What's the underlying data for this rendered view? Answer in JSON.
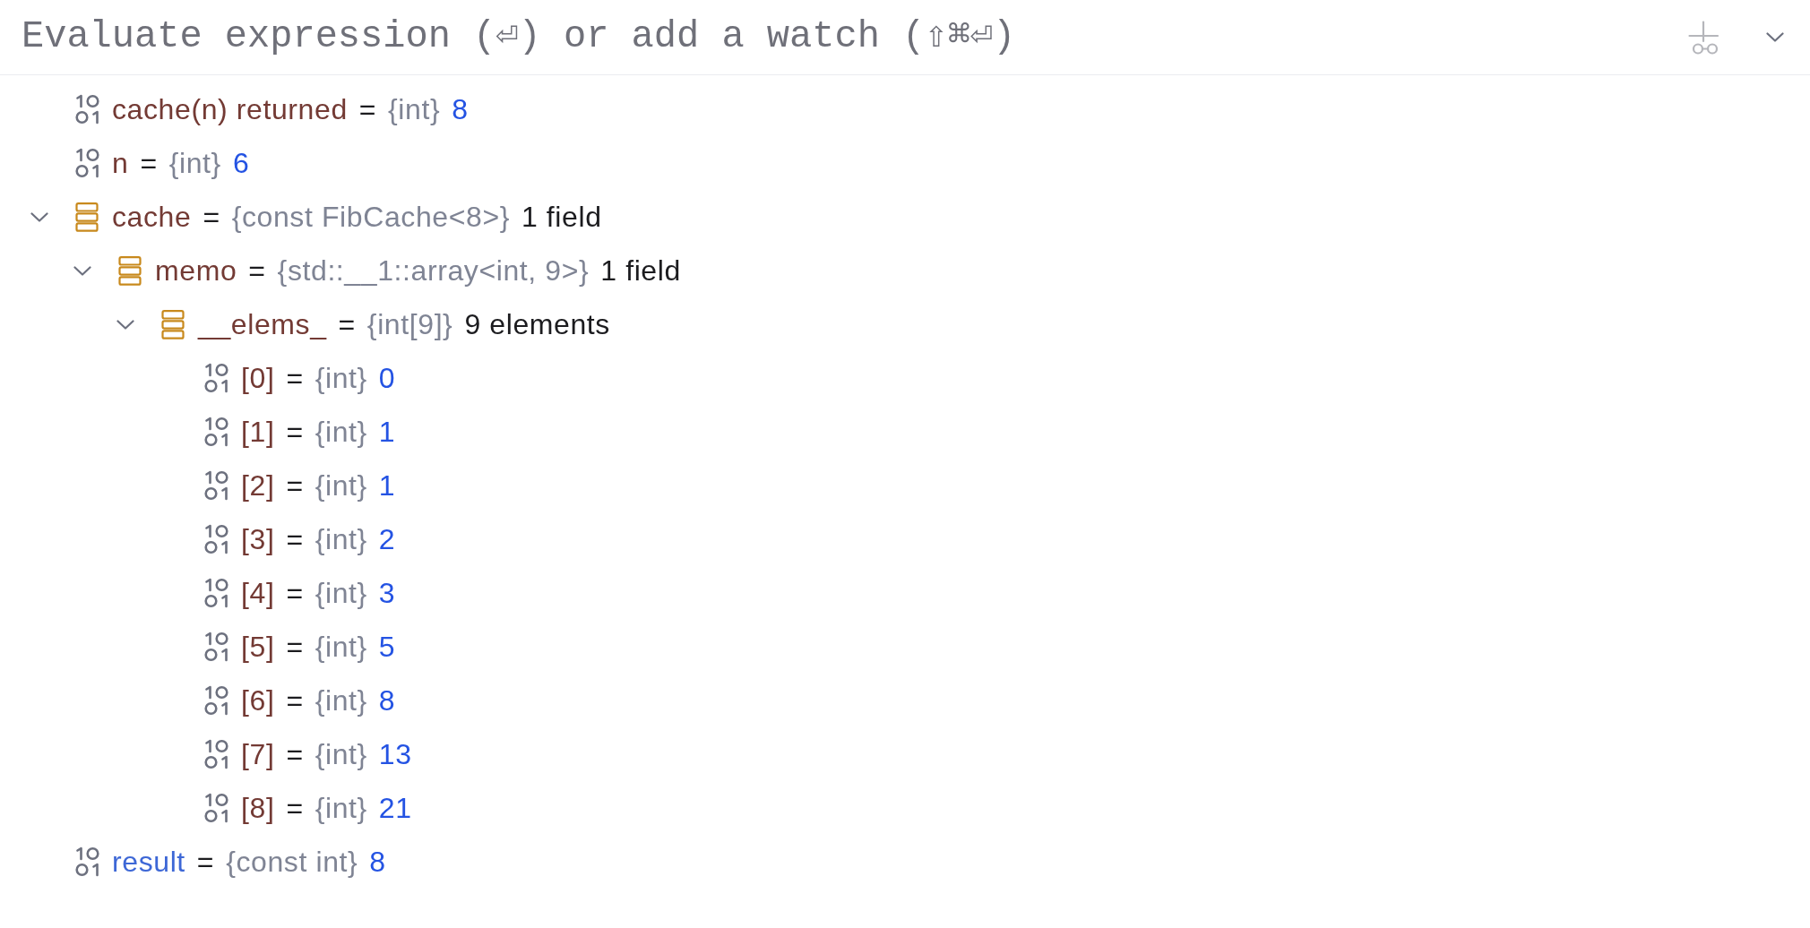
{
  "evaluate_bar": {
    "placeholder": "Evaluate expression (⏎) or add a watch (⇧⌘⏎)"
  },
  "variables": [
    {
      "kind": "primitive",
      "name": "cache(n) returned",
      "color": "#733a34",
      "operator": "=",
      "type": "{int}",
      "value": "8"
    },
    {
      "kind": "primitive",
      "name": "n",
      "color": "#733a34",
      "operator": "=",
      "type": "{int}",
      "value": "6"
    },
    {
      "kind": "struct",
      "name": "cache",
      "color": "#733a34",
      "operator": "=",
      "type": "{const FibCache<8>}",
      "value": "1 field",
      "expanded": true,
      "children": [
        {
          "kind": "struct",
          "name": "memo",
          "color": "#733a34",
          "operator": "=",
          "type": "{std::__1::array<int, 9>}",
          "value": "1 field",
          "expanded": true,
          "children": [
            {
              "kind": "struct",
              "name": "__elems_",
              "color": "#733a34",
              "operator": "=",
              "type": "{int[9]}",
              "value": "9 elements",
              "expanded": true,
              "children": [
                {
                  "kind": "primitive",
                  "name": "[0]",
                  "color": "#733a34",
                  "operator": "=",
                  "type": "{int}",
                  "value": "0"
                },
                {
                  "kind": "primitive",
                  "name": "[1]",
                  "color": "#733a34",
                  "operator": "=",
                  "type": "{int}",
                  "value": "1"
                },
                {
                  "kind": "primitive",
                  "name": "[2]",
                  "color": "#733a34",
                  "operator": "=",
                  "type": "{int}",
                  "value": "1"
                },
                {
                  "kind": "primitive",
                  "name": "[3]",
                  "color": "#733a34",
                  "operator": "=",
                  "type": "{int}",
                  "value": "2"
                },
                {
                  "kind": "primitive",
                  "name": "[4]",
                  "color": "#733a34",
                  "operator": "=",
                  "type": "{int}",
                  "value": "3"
                },
                {
                  "kind": "primitive",
                  "name": "[5]",
                  "color": "#733a34",
                  "operator": "=",
                  "type": "{int}",
                  "value": "5"
                },
                {
                  "kind": "primitive",
                  "name": "[6]",
                  "color": "#733a34",
                  "operator": "=",
                  "type": "{int}",
                  "value": "8"
                },
                {
                  "kind": "primitive",
                  "name": "[7]",
                  "color": "#733a34",
                  "operator": "=",
                  "type": "{int}",
                  "value": "13"
                },
                {
                  "kind": "primitive",
                  "name": "[8]",
                  "color": "#733a34",
                  "operator": "=",
                  "type": "{int}",
                  "value": "21"
                }
              ]
            }
          ]
        }
      ]
    },
    {
      "kind": "primitive",
      "name": "result",
      "color": "#3d67d6",
      "operator": "=",
      "type": "{const int}",
      "value": "8"
    }
  ]
}
